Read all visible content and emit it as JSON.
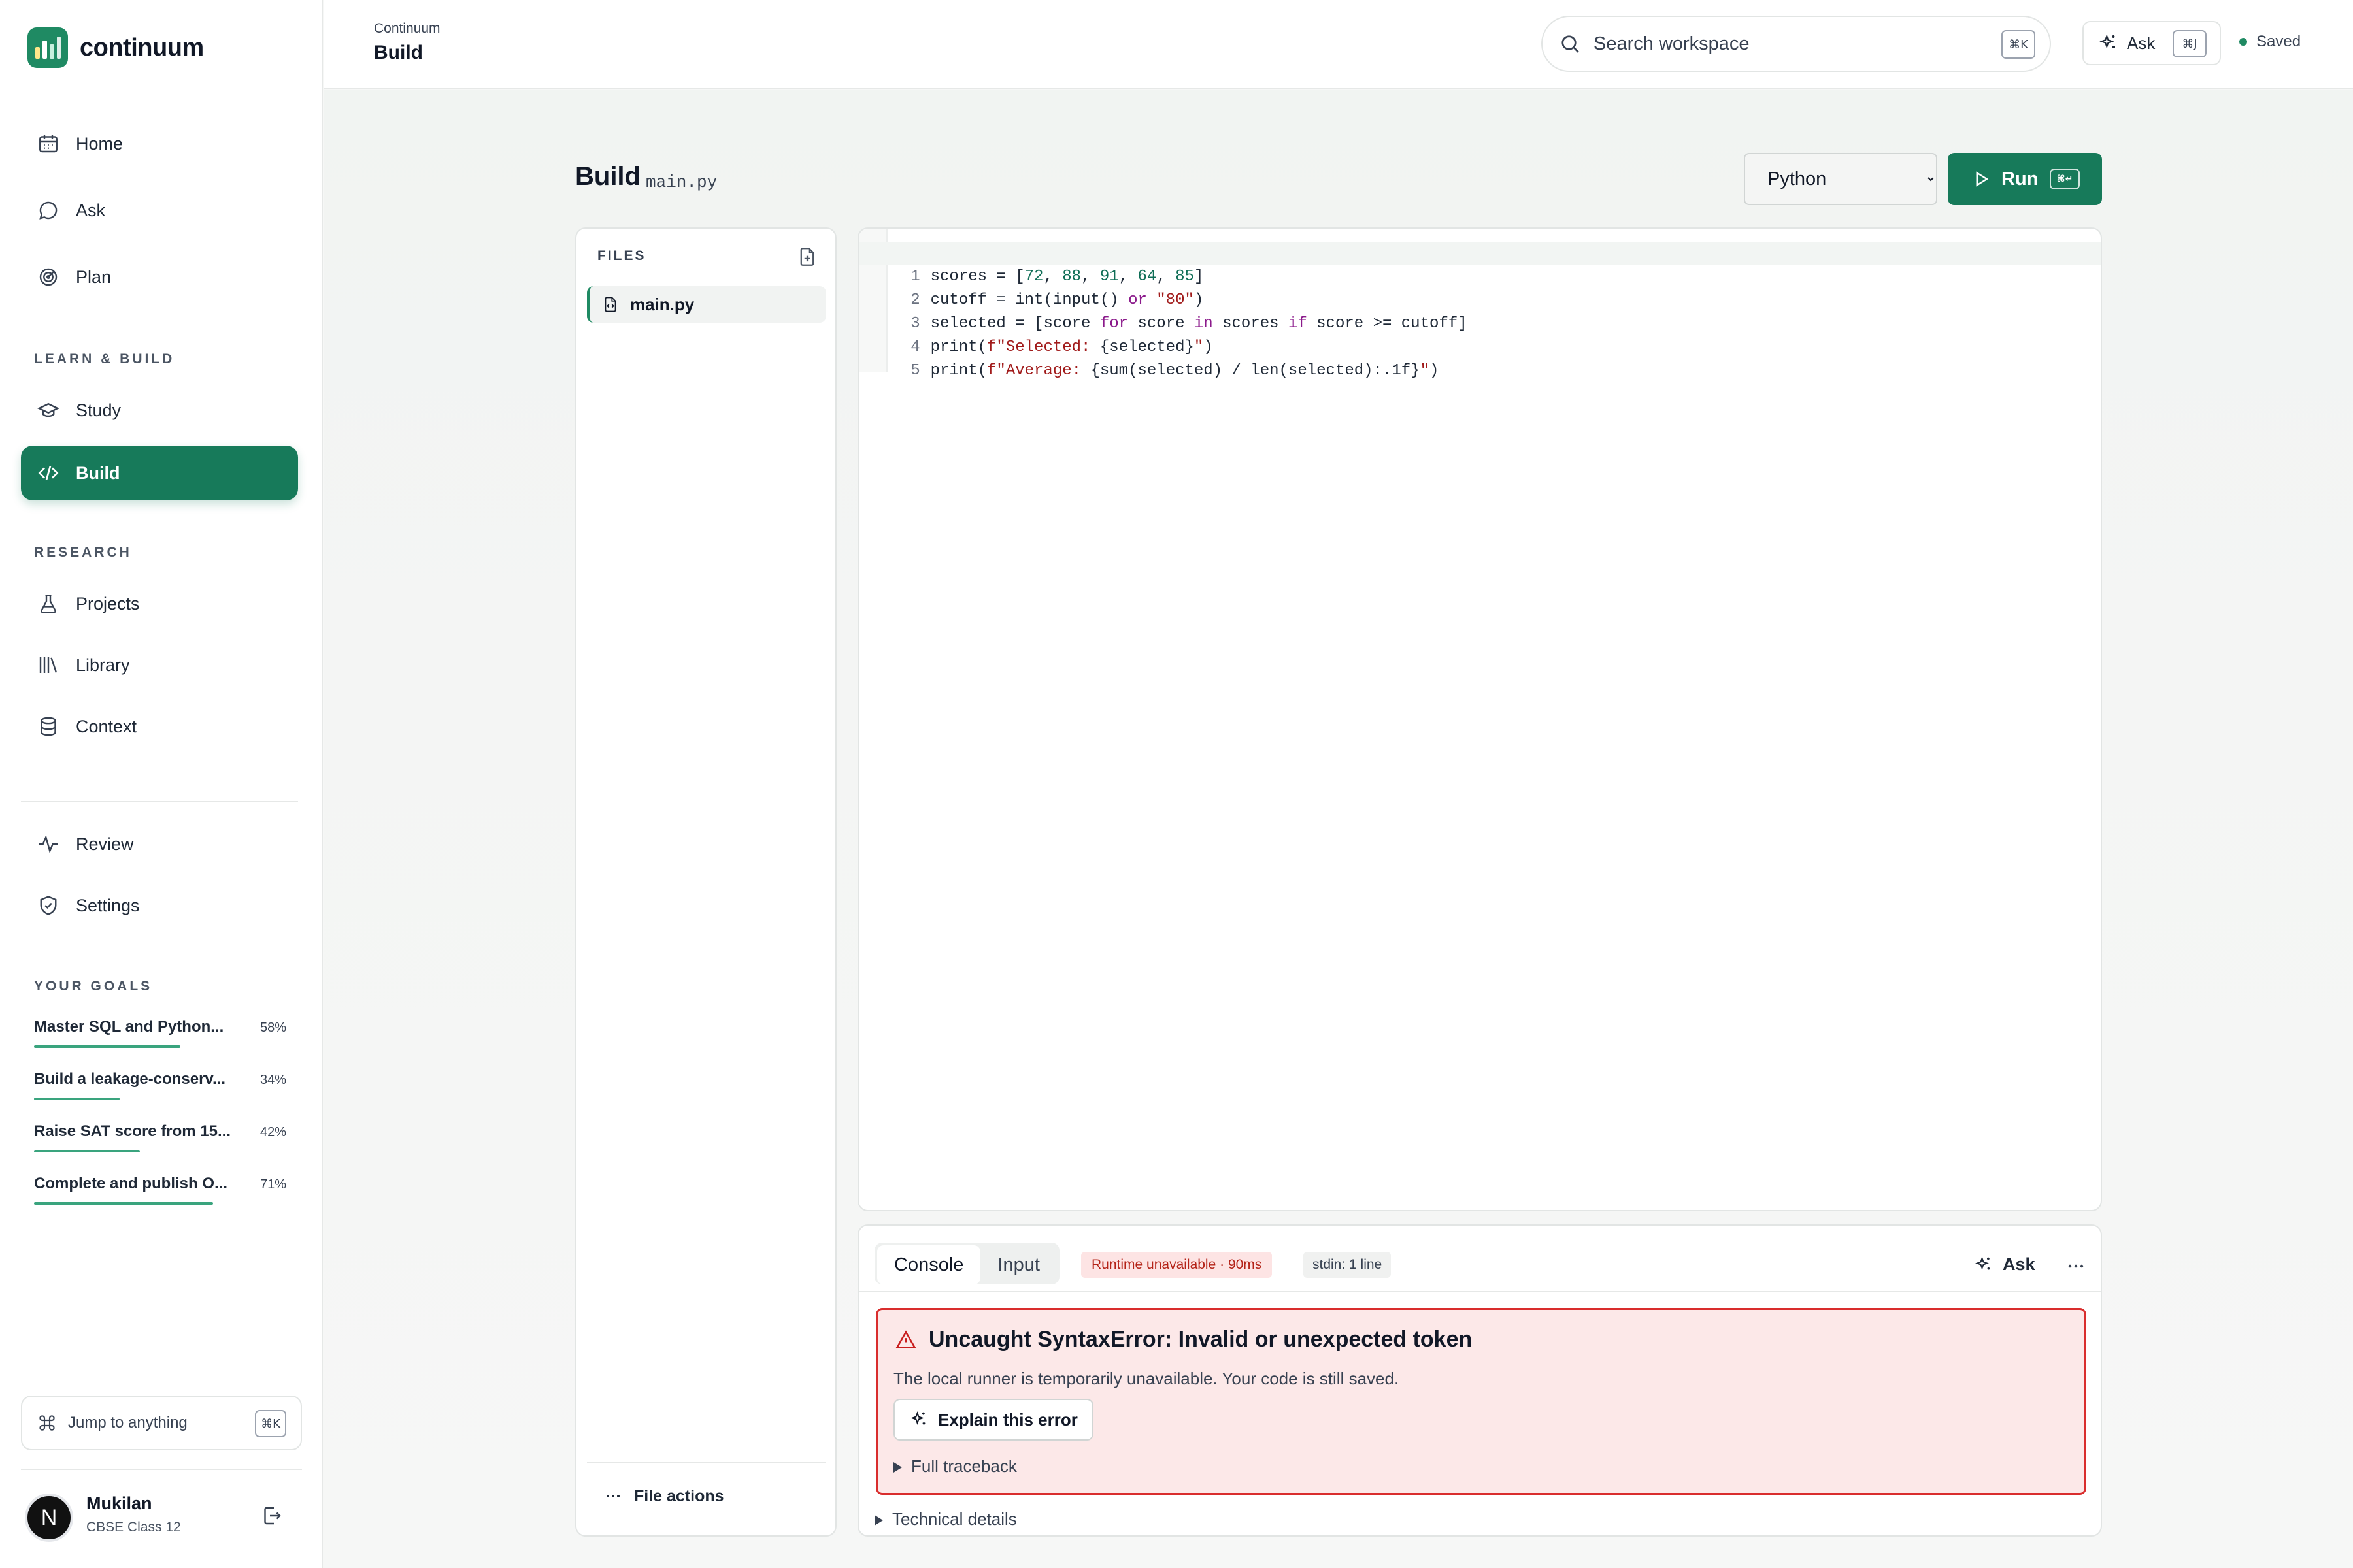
{
  "app": {
    "name": "continuum",
    "brand_color": "#1f8a63"
  },
  "sidebar": {
    "nav_main": [
      {
        "label": "Home",
        "icon": "calendar-icon"
      },
      {
        "label": "Ask",
        "icon": "chat-bubble-icon"
      },
      {
        "label": "Plan",
        "icon": "target-icon"
      }
    ],
    "section_learn": "LEARN & BUILD",
    "nav_learn": [
      {
        "label": "Study",
        "icon": "graduation-cap-icon"
      },
      {
        "label": "Build",
        "icon": "code-icon",
        "active": true
      }
    ],
    "section_research": "RESEARCH",
    "nav_research": [
      {
        "label": "Projects",
        "icon": "flask-icon"
      },
      {
        "label": "Library",
        "icon": "books-icon"
      },
      {
        "label": "Context",
        "icon": "database-icon"
      }
    ],
    "nav_bottom": [
      {
        "label": "Review",
        "icon": "activity-icon"
      },
      {
        "label": "Settings",
        "icon": "shield-icon"
      }
    ],
    "section_goals": "YOUR GOALS",
    "goals": [
      {
        "title": "Master SQL and Python...",
        "pct_label": "58%",
        "progress": 0.58
      },
      {
        "title": "Build a leakage-conserv...",
        "pct_label": "34%",
        "progress": 0.34
      },
      {
        "title": "Raise SAT score from 15...",
        "pct_label": "42%",
        "progress": 0.42
      },
      {
        "title": "Complete and publish O...",
        "pct_label": "71%",
        "progress": 0.71
      }
    ],
    "jump": {
      "label": "Jump to anything",
      "shortcut": "⌘K"
    },
    "user": {
      "initial": "N",
      "name": "Mukilan",
      "subtitle": "CBSE Class 12"
    }
  },
  "header": {
    "breadcrumb": "Continuum",
    "title": "Build",
    "search": {
      "placeholder": "Search workspace",
      "shortcut": "⌘K"
    },
    "ask": {
      "label": "Ask",
      "shortcut": "⌘J"
    },
    "status": "Saved"
  },
  "page": {
    "title": "Build",
    "filename": "main.py",
    "language": {
      "selected": "Python",
      "options": [
        "Python"
      ]
    },
    "run": {
      "label": "Run",
      "shortcut": "⌘↵"
    }
  },
  "files": {
    "heading": "FILES",
    "items": [
      {
        "name": "main.py"
      }
    ],
    "actions_label": "File actions"
  },
  "editor": {
    "lines": [
      "scores = [72, 88, 91, 64, 85]",
      "cutoff = int(input() or \"80\")",
      "selected = [score for score in scores if score >= cutoff]",
      "print(f\"Selected: {selected}\")",
      "print(f\"Average: {sum(selected) / len(selected):.1f}\")"
    ],
    "line_numbers": [
      "1",
      "2",
      "3",
      "4",
      "5"
    ]
  },
  "console": {
    "tabs": [
      {
        "label": "Console",
        "active": true
      },
      {
        "label": "Input",
        "active": false
      }
    ],
    "status_badge": "Runtime unavailable · 90ms",
    "stdin_badge": "stdin: 1 line",
    "ask_label": "Ask",
    "error": {
      "title": "Uncaught SyntaxError: Invalid or unexpected token",
      "message": "The local runner is temporarily unavailable. Your code is still saved.",
      "explain_label": "Explain this error",
      "traceback_label": "Full traceback"
    },
    "technical_label": "Technical details",
    "error_color": "#d92d2d"
  }
}
